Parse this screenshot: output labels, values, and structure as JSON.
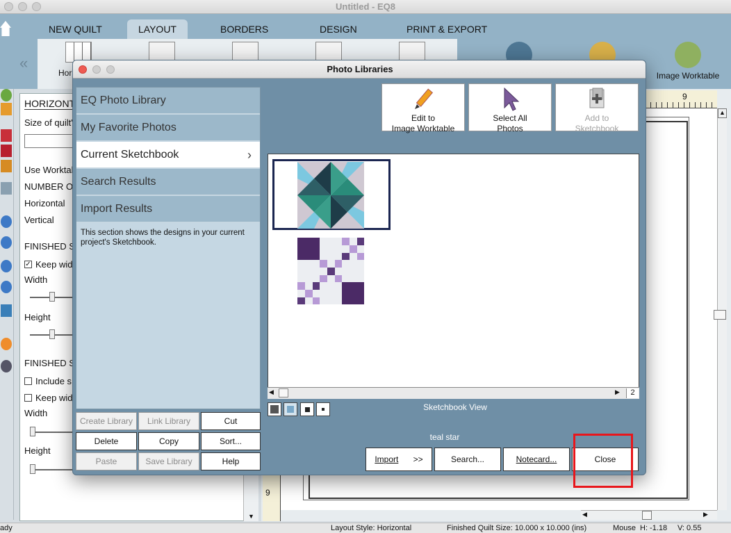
{
  "app": {
    "window_title": "Untitled - EQ8"
  },
  "ribbon": {
    "tabs": [
      {
        "label": "NEW QUILT"
      },
      {
        "label": "LAYOUT",
        "active": true
      },
      {
        "label": "BORDERS"
      },
      {
        "label": "DESIGN"
      },
      {
        "label": "PRINT & EXPORT"
      }
    ],
    "home_label": "Hor",
    "image_worktable_label": "Image Worktable"
  },
  "left_panel": {
    "title": "HORIZONT",
    "size_label": "Size of quilt'",
    "use_worktable": "Use Worktab",
    "number_of": "NUMBER OF",
    "horizontal": "Horizontal",
    "vertical": "Vertical",
    "finished_1": "FINISHED SI",
    "keep_width_1": "Keep wid",
    "width_1": "Width",
    "height_1": "Height",
    "finished_2": "FINISHED SI",
    "include": "Include s",
    "keep_width_2": "Keep wid",
    "width_2": "Width",
    "height_2": "Height"
  },
  "dialog": {
    "title": "Photo Libraries",
    "libraries": [
      {
        "label": "EQ Photo Library"
      },
      {
        "label": "My Favorite Photos"
      },
      {
        "label": "Current Sketchbook",
        "selected": true
      },
      {
        "label": "Search Results"
      },
      {
        "label": "Import Results"
      }
    ],
    "description": "This section shows the designs in your current project's Sketchbook.",
    "library_buttons": {
      "create_library": "Create Library",
      "link_library": "Link Library",
      "cut": "Cut",
      "delete": "Delete",
      "copy": "Copy",
      "sort": "Sort...",
      "paste": "Paste",
      "save_library": "Save Library",
      "help": "Help"
    },
    "top_buttons": {
      "edit_to": "Edit to",
      "image_worktable": "Image Worktable",
      "select_all": "Select All",
      "photos": "Photos",
      "add_to": "Add to",
      "sketchbook": "Sketchbook"
    },
    "page_number": "2",
    "view_label": "Sketchbook View",
    "selected_name": "teal star",
    "bottom_buttons": {
      "import": "Import",
      "import_arrows": ">>",
      "search": "Search...",
      "notecard": "Notecard...",
      "close": "Close"
    }
  },
  "ruler": {
    "top_tick": "9",
    "left_tick": "9"
  },
  "status": {
    "ready": "ady",
    "layout_style": "Layout Style: Horizontal",
    "quilt_size": "Finished Quilt Size: 10.000 x 10.000 (ins)",
    "mouse": "Mouse",
    "h": "H:  -1.18",
    "v": "V:  0.55"
  },
  "colors": {
    "ribbon": "#93b2c6",
    "dialog": "#6f8fa6",
    "highlight": "#e8161b"
  }
}
